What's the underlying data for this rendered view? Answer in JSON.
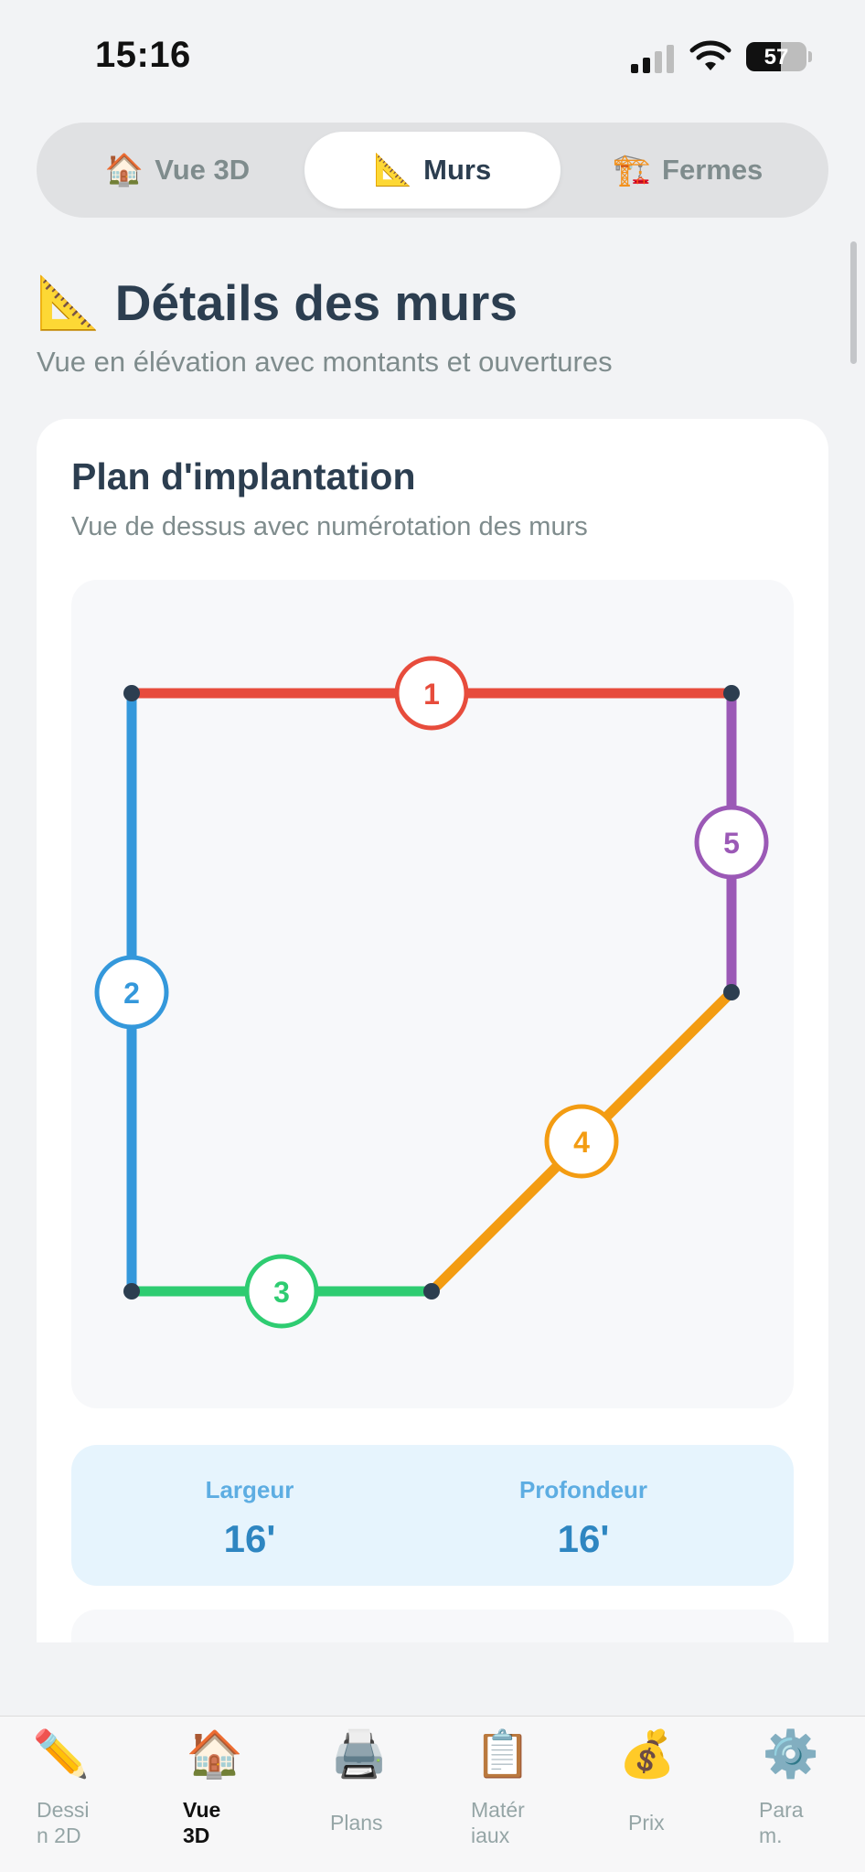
{
  "status_bar": {
    "time": "15:16",
    "battery": "57",
    "battery_level": 0.57
  },
  "segmented": {
    "tabs": [
      {
        "icon": "🏠",
        "label": "Vue 3D"
      },
      {
        "icon": "📐",
        "label": "Murs"
      },
      {
        "icon": "🏗️",
        "label": "Fermes"
      }
    ],
    "active_index": 1
  },
  "page": {
    "icon": "📐",
    "title": "Détails des murs",
    "subtitle": "Vue en élévation avec montants et ouvertures"
  },
  "plan_card": {
    "title": "Plan d'implantation",
    "subtitle": "Vue de dessus avec numérotation des murs",
    "walls": [
      {
        "number": "1",
        "color": "#e74c3c"
      },
      {
        "number": "2",
        "color": "#3498db"
      },
      {
        "number": "3",
        "color": "#2ecc71"
      },
      {
        "number": "4",
        "color": "#f39c12"
      },
      {
        "number": "5",
        "color": "#9b59b6"
      }
    ],
    "dimensions": {
      "width_label": "Largeur",
      "width_value": "16'",
      "depth_label": "Profondeur",
      "depth_value": "16'"
    }
  },
  "tabbar": {
    "items": [
      {
        "icon": "✏️",
        "label": "Dessi\nn 2D"
      },
      {
        "icon": "🏠",
        "label": "Vue\n3D"
      },
      {
        "icon": "🖨️",
        "label": "Plans"
      },
      {
        "icon": "📋",
        "label": "Matér\niaux"
      },
      {
        "icon": "💰",
        "label": "Prix"
      },
      {
        "icon": "⚙️",
        "label": "Para\nm."
      }
    ],
    "active_index": 1
  },
  "colors": {
    "accent": "#2e86c1",
    "text": "#2c3e50",
    "muted": "#7f8c8d"
  }
}
